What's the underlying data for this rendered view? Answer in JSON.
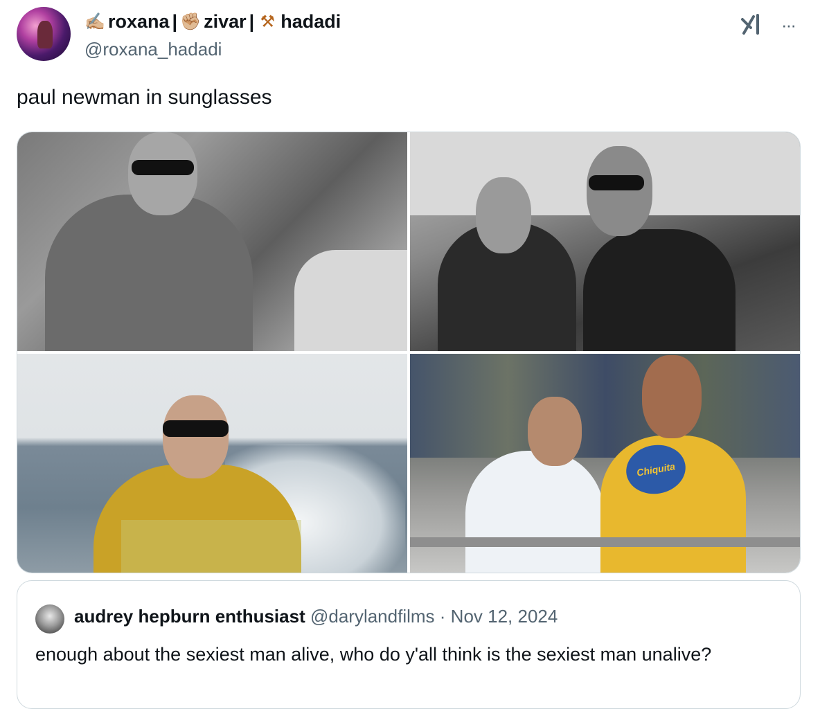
{
  "author": {
    "display_name_parts": [
      "roxana",
      "zivar",
      "hadadi"
    ],
    "separator": "|",
    "emojis": [
      "✍🏼",
      "✊🏼",
      "⚒"
    ],
    "handle": "@roxana_hadadi"
  },
  "actions": {
    "grok_icon": "grok-icon",
    "more_label": "···"
  },
  "tweet": {
    "text": "paul newman in sunglasses"
  },
  "media": {
    "photo_count": 4,
    "badge_text": "Chiquita"
  },
  "quote": {
    "name": "audrey hepburn enthusiast",
    "handle": "@darylandfilms",
    "dot": "·",
    "date": "Nov 12, 2024",
    "text": "enough about the sexiest man alive, who do y'all think is the sexiest man unalive?"
  }
}
